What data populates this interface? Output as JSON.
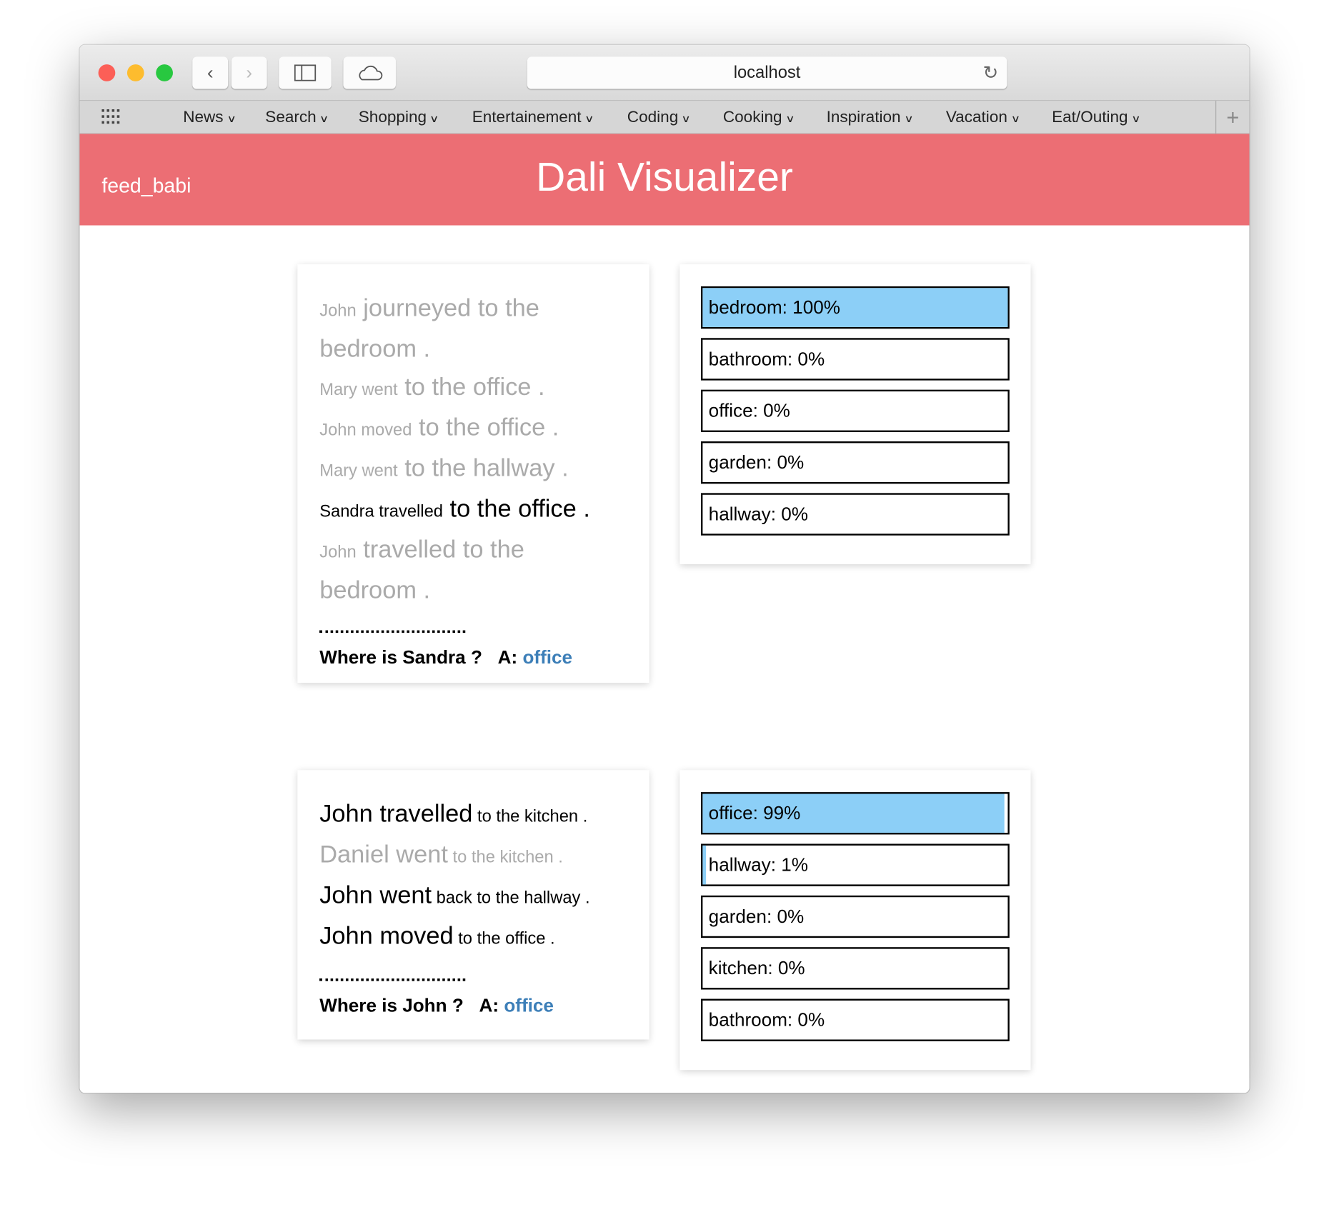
{
  "browser": {
    "address": "localhost",
    "bookmarks": [
      "News",
      "Search",
      "Shopping",
      "Entertainement",
      "Coding",
      "Cooking",
      "Inspiration",
      "Vacation",
      "Eat/Outing"
    ],
    "traffic_colors": [
      "#fc5f57",
      "#fdbc2e",
      "#28c840"
    ]
  },
  "header": {
    "brand": "feed_babi",
    "title": "Dali Visualizer",
    "color": "#ec6e74"
  },
  "examples": [
    {
      "story": [
        {
          "active": false,
          "segments": [
            {
              "t": "John",
              "small": true
            },
            {
              "t": " journeyed to the bedroom .",
              "small": false
            }
          ]
        },
        {
          "active": false,
          "segments": [
            {
              "t": "Mary went",
              "small": true
            },
            {
              "t": " to the office .",
              "small": false
            }
          ]
        },
        {
          "active": false,
          "segments": [
            {
              "t": "John moved",
              "small": true
            },
            {
              "t": " to the office .",
              "small": false
            }
          ]
        },
        {
          "active": false,
          "segments": [
            {
              "t": "Mary went",
              "small": true
            },
            {
              "t": " to the hallway .",
              "small": false
            }
          ]
        },
        {
          "active": true,
          "segments": [
            {
              "t": "Sandra travelled",
              "small": true
            },
            {
              "t": " to the office .",
              "small": false
            }
          ]
        },
        {
          "active": false,
          "segments": [
            {
              "t": "John",
              "small": true
            },
            {
              "t": " travelled to the bedroom .",
              "small": false
            }
          ]
        }
      ],
      "question": "Where is Sandra ?",
      "answer_label": "A:",
      "answer": "office",
      "predictions": [
        {
          "label": "bedroom: 100%",
          "value": 100
        },
        {
          "label": "bathroom: 0%",
          "value": 0
        },
        {
          "label": "office: 0%",
          "value": 0
        },
        {
          "label": "garden: 0%",
          "value": 0
        },
        {
          "label": "hallway: 0%",
          "value": 0
        }
      ]
    },
    {
      "story": [
        {
          "active": true,
          "segments": [
            {
              "t": "John travelled",
              "small": false
            },
            {
              "t": " to the kitchen .",
              "small": true
            }
          ]
        },
        {
          "active": false,
          "segments": [
            {
              "t": "Daniel went",
              "small": false
            },
            {
              "t": " to the kitchen .",
              "small": true
            }
          ]
        },
        {
          "active": true,
          "segments": [
            {
              "t": "John went",
              "small": false
            },
            {
              "t": " back to the hallway .",
              "small": true
            }
          ]
        },
        {
          "active": true,
          "segments": [
            {
              "t": "John moved",
              "small": false
            },
            {
              "t": " to the office .",
              "small": true
            }
          ]
        }
      ],
      "question": "Where is John ?",
      "answer_label": "A:",
      "answer": "office",
      "predictions": [
        {
          "label": "office: 99%",
          "value": 99
        },
        {
          "label": "hallway: 1%",
          "value": 1
        },
        {
          "label": "garden: 0%",
          "value": 0
        },
        {
          "label": "kitchen: 0%",
          "value": 0
        },
        {
          "label": "bathroom: 0%",
          "value": 0
        }
      ]
    }
  ],
  "bar_fill_color": "#8ccff7"
}
